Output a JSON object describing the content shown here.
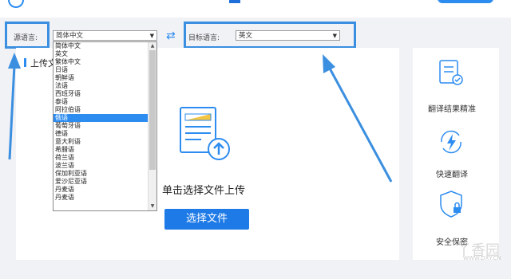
{
  "header": {},
  "source": {
    "label": "源语言:",
    "value": "简体中文"
  },
  "swap": {
    "icon": "swap-icon"
  },
  "target": {
    "label": "目标语言:",
    "value": "英文"
  },
  "upload": {
    "header": "上传文",
    "click_text": "单击选择文件上传",
    "button": "选择文件"
  },
  "dropdown": {
    "items": [
      "简体中文",
      "英文",
      "繁体中文",
      "日语",
      "朝鲜语",
      "法语",
      "西班牙语",
      "泰语",
      "阿拉伯语",
      "俄语",
      "葡萄牙语",
      "德语",
      "意大利语",
      "希腊语",
      "荷兰语",
      "波兰语",
      "保加利亚语",
      "爱沙尼亚语",
      "丹麦语",
      "丹麦语"
    ],
    "selected_index": 9
  },
  "features": [
    {
      "label": "翻译结果精准",
      "icon": "accuracy-icon"
    },
    {
      "label": "快速翻译",
      "icon": "lightning-icon"
    },
    {
      "label": "安全保密",
      "icon": "shield-lock-icon"
    }
  ],
  "watermark": {
    "text": "丫香园",
    "sub": "WWW.DXY.CN"
  },
  "colors": {
    "accent": "#2d8cf0",
    "highlight": "#3b8fe0",
    "button": "#1e7ae6"
  }
}
